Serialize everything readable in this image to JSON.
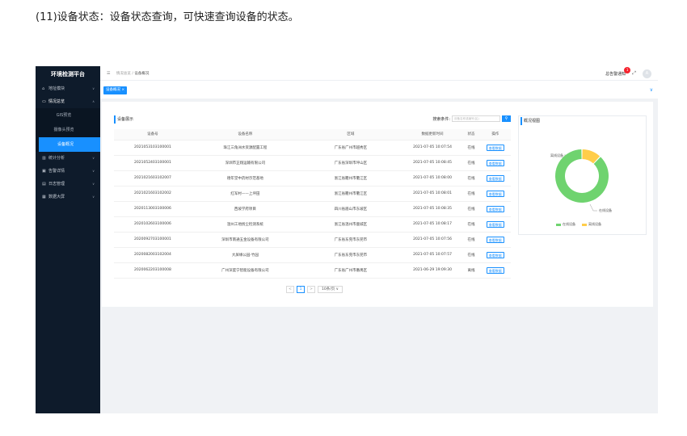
{
  "caption": "(11)设备状态：设备状态查询，可快速查询设备的状态。",
  "sidebar": {
    "brand": "环境检测平台",
    "items": [
      {
        "label": "地址模块",
        "icon": "home-icon",
        "glyph": "⌂"
      },
      {
        "label": "情况总览",
        "icon": "monitor-icon",
        "glyph": "▭",
        "open": true
      },
      {
        "label": "统计分析",
        "icon": "bar-chart-icon",
        "glyph": "▥"
      },
      {
        "label": "告警详情",
        "icon": "alert-icon",
        "glyph": "▣"
      },
      {
        "label": "日志管理",
        "icon": "document-icon",
        "glyph": "▤"
      },
      {
        "label": "数据大屏",
        "icon": "screen-icon",
        "glyph": "▦"
      }
    ],
    "submenu": [
      "GIS预览",
      "摄像头预览",
      "设备概况"
    ]
  },
  "header": {
    "breadcrumb_parent": "情况总览",
    "breadcrumb_sep": "/",
    "breadcrumb_current": "设备概况",
    "user": "总告警通知",
    "badge_count": "1",
    "avatar_letter": "A"
  },
  "tabs": {
    "active": "设备概况 ×"
  },
  "devices": {
    "title": "设备展示",
    "search_label": "搜索条件:",
    "search_placeholder": "设备名称或编号(区)",
    "columns": [
      "设备号",
      "设备名称",
      "区域",
      "数据更新时间",
      "状态",
      "操作"
    ],
    "rows": [
      [
        "2021053103100001",
        "珠江三角洲水资源配置工程",
        "广东省广州市越秀区",
        "2021-07-05 10:07:54",
        "在线",
        "查看数据"
      ],
      [
        "2021052403100001",
        "深圳市正翔运输有限公司",
        "广东省深圳市坪山区",
        "2021-07-05 10:08:45",
        "在线",
        "查看数据"
      ],
      [
        "2021021603102007",
        "德年堂中药材示范基地",
        "浙江省衢州市衢江区",
        "2021-07-05 10:08:00",
        "在线",
        "查看数据"
      ],
      [
        "2021021603102002",
        "红军村——上坪田",
        "浙江省衢州市衢江区",
        "2021-07-05 10:08:01",
        "在线",
        "查看数据"
      ],
      [
        "2020113003100006",
        "西坡学府项目",
        "四川省眉山市东坡区",
        "2021-07-05 10:08:35",
        "在线",
        "查看数据"
      ],
      [
        "2020102603100006",
        "温州工地扬尘检测系统",
        "浙江省温州市鹿城区",
        "2021-07-05 10:08:17",
        "在线",
        "查看数据"
      ],
      [
        "2020092703100001",
        "深圳市南通五金设备有限公司",
        "广东省东莞市东莞市",
        "2021-07-05 10:07:56",
        "在线",
        "查看数据"
      ],
      [
        "2020082003102004",
        "大屏缘公园-竹园",
        "广东省东莞市东莞市",
        "2021-07-05 10:07:57",
        "在线",
        "查看数据"
      ],
      [
        "2020062203100008",
        "广州深度宁智能设备有限公司",
        "广东省广州市番禺区",
        "2021-06-29 19:09:30",
        "离线",
        "查看数据"
      ]
    ],
    "pager": {
      "prev": "<",
      "page": "1",
      "next": ">",
      "size": "10条/页 ∨"
    }
  },
  "overview": {
    "title": "概况视图",
    "online_label": "在线设备",
    "offline_label": "离线设备",
    "online_value": 88,
    "offline_value": 12,
    "online_color": "#6fd36f",
    "offline_color": "#ffcd4a"
  }
}
